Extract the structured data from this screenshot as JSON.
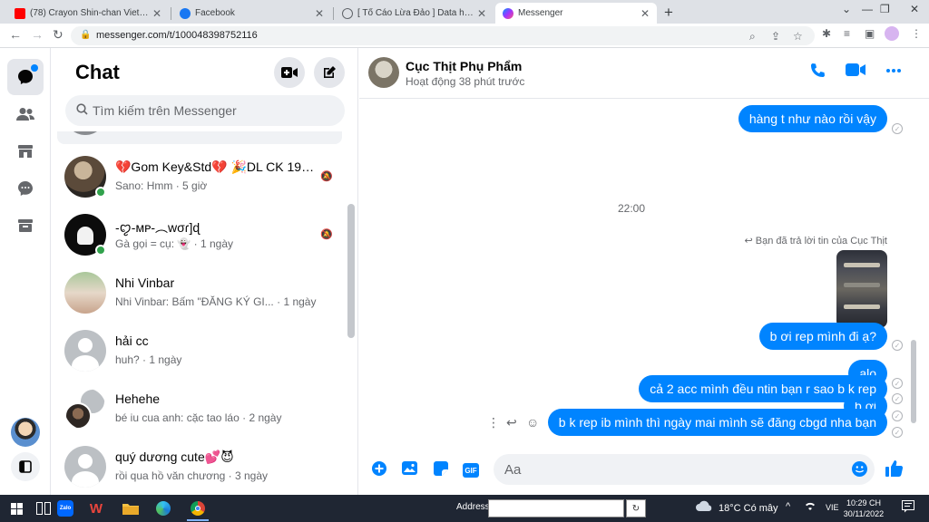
{
  "browser": {
    "tabs": [
      {
        "title": "(78) Crayon Shin-chan Vietsub: M",
        "favicon": "youtube-icon",
        "color": "#ff0000"
      },
      {
        "title": "Facebook",
        "favicon": "facebook-icon",
        "color": "#1877f2"
      },
      {
        "title": "[ Tố Cáo Lừa Đảo ] Data hệ thống",
        "favicon": "globe-icon",
        "color": "#5f6368"
      },
      {
        "title": "Messenger",
        "favicon": "messenger-icon",
        "color": "#a033ff"
      }
    ],
    "url": "messenger.com/t/100048398752116"
  },
  "chatlist": {
    "title": "Chat",
    "search_placeholder": "Tìm kiếm trên Messenger",
    "conversations": [
      {
        "name": "💔Gom Key&Std💔 🎉DL CK 19/…",
        "preview": "Sano: Hmm",
        "time": "5 giờ",
        "online": true,
        "muted": true
      },
      {
        "name": "-ꨄ︎-ᴍᴘ-︵ᴡσɾ]ɖ",
        "preview": "Gà gọi = cụ: 👻",
        "time": "1 ngày",
        "online": true,
        "muted": true
      },
      {
        "name": "Nhi Vinbar",
        "preview": "Nhi Vinbar: Bấm \"ĐĂNG KÝ GI...",
        "time": "1 ngày",
        "online": false,
        "muted": false
      },
      {
        "name": "hải cc",
        "preview": "huh?",
        "time": "1 ngày",
        "online": false,
        "muted": false
      },
      {
        "name": "Hehehe",
        "preview": "bé iu cua anh: cặc tao láo",
        "time": "2 ngày",
        "online": false,
        "muted": false
      },
      {
        "name": "quý dương cute💕😈",
        "preview": "rồi qua hồ văn chương",
        "time": "3 ngày",
        "online": false,
        "muted": false
      }
    ]
  },
  "conversation": {
    "name": "Cục Thịt Phụ Phẩm",
    "status": "Hoạt động 38 phút trước",
    "timestamp": "22:00",
    "reply_note": "Bạn đã trả lời tin của Cục Thịt",
    "messages": [
      "hàng t như nào rồi vậy",
      "b ơi rep mình đi ạ?",
      "alo",
      "b ơi",
      "cả 2 acc mình đều ntin bạn r sao b k rep",
      "b k rep ib mình thì ngày mai mình sẽ đăng cbgd nha bạn"
    ],
    "input_placeholder": "Aa"
  },
  "taskbar": {
    "address_label": "Address",
    "weather": "18°C Có mây",
    "lang": "VIE",
    "time": "10:29 CH",
    "date": "30/11/2022"
  },
  "colors": {
    "accent": "#0084ff",
    "online": "#31a24c"
  }
}
